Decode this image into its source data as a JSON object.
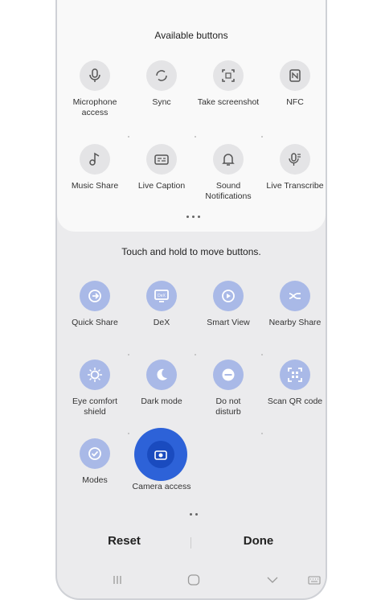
{
  "available": {
    "title": "Available buttons",
    "row1": [
      {
        "label": "Microphone\naccess",
        "icon": "microphone-icon"
      },
      {
        "label": "Sync",
        "icon": "sync-icon"
      },
      {
        "label": "Take screenshot",
        "icon": "screenshot-icon"
      },
      {
        "label": "NFC",
        "icon": "nfc-icon"
      }
    ],
    "row2": [
      {
        "label": "Music Share",
        "icon": "music-share-icon"
      },
      {
        "label": "Live Caption",
        "icon": "live-caption-icon"
      },
      {
        "label": "Sound\nNotifications",
        "icon": "sound-notifications-icon"
      },
      {
        "label": "Live Transcribe",
        "icon": "live-transcribe-icon"
      }
    ]
  },
  "active": {
    "hint": "Touch and hold to move buttons.",
    "row1": [
      {
        "label": "Quick Share",
        "icon": "quick-share-icon"
      },
      {
        "label": "DeX",
        "icon": "dex-icon"
      },
      {
        "label": "Smart View",
        "icon": "smart-view-icon"
      },
      {
        "label": "Nearby Share",
        "icon": "nearby-share-icon"
      }
    ],
    "row2": [
      {
        "label": "Eye comfort\nshield",
        "icon": "eye-comfort-icon"
      },
      {
        "label": "Dark mode",
        "icon": "dark-mode-icon"
      },
      {
        "label": "Do not\ndisturb",
        "icon": "do-not-disturb-icon"
      },
      {
        "label": "Scan QR code",
        "icon": "qr-code-icon"
      }
    ],
    "row3": [
      {
        "label": "Modes",
        "icon": "modes-icon"
      },
      {
        "label": "Camera access",
        "icon": "camera-access-icon"
      }
    ]
  },
  "footer": {
    "reset": "Reset",
    "done": "Done"
  },
  "colors": {
    "active_circle": "#a9b9e7",
    "highlight": "#2d62d8"
  }
}
